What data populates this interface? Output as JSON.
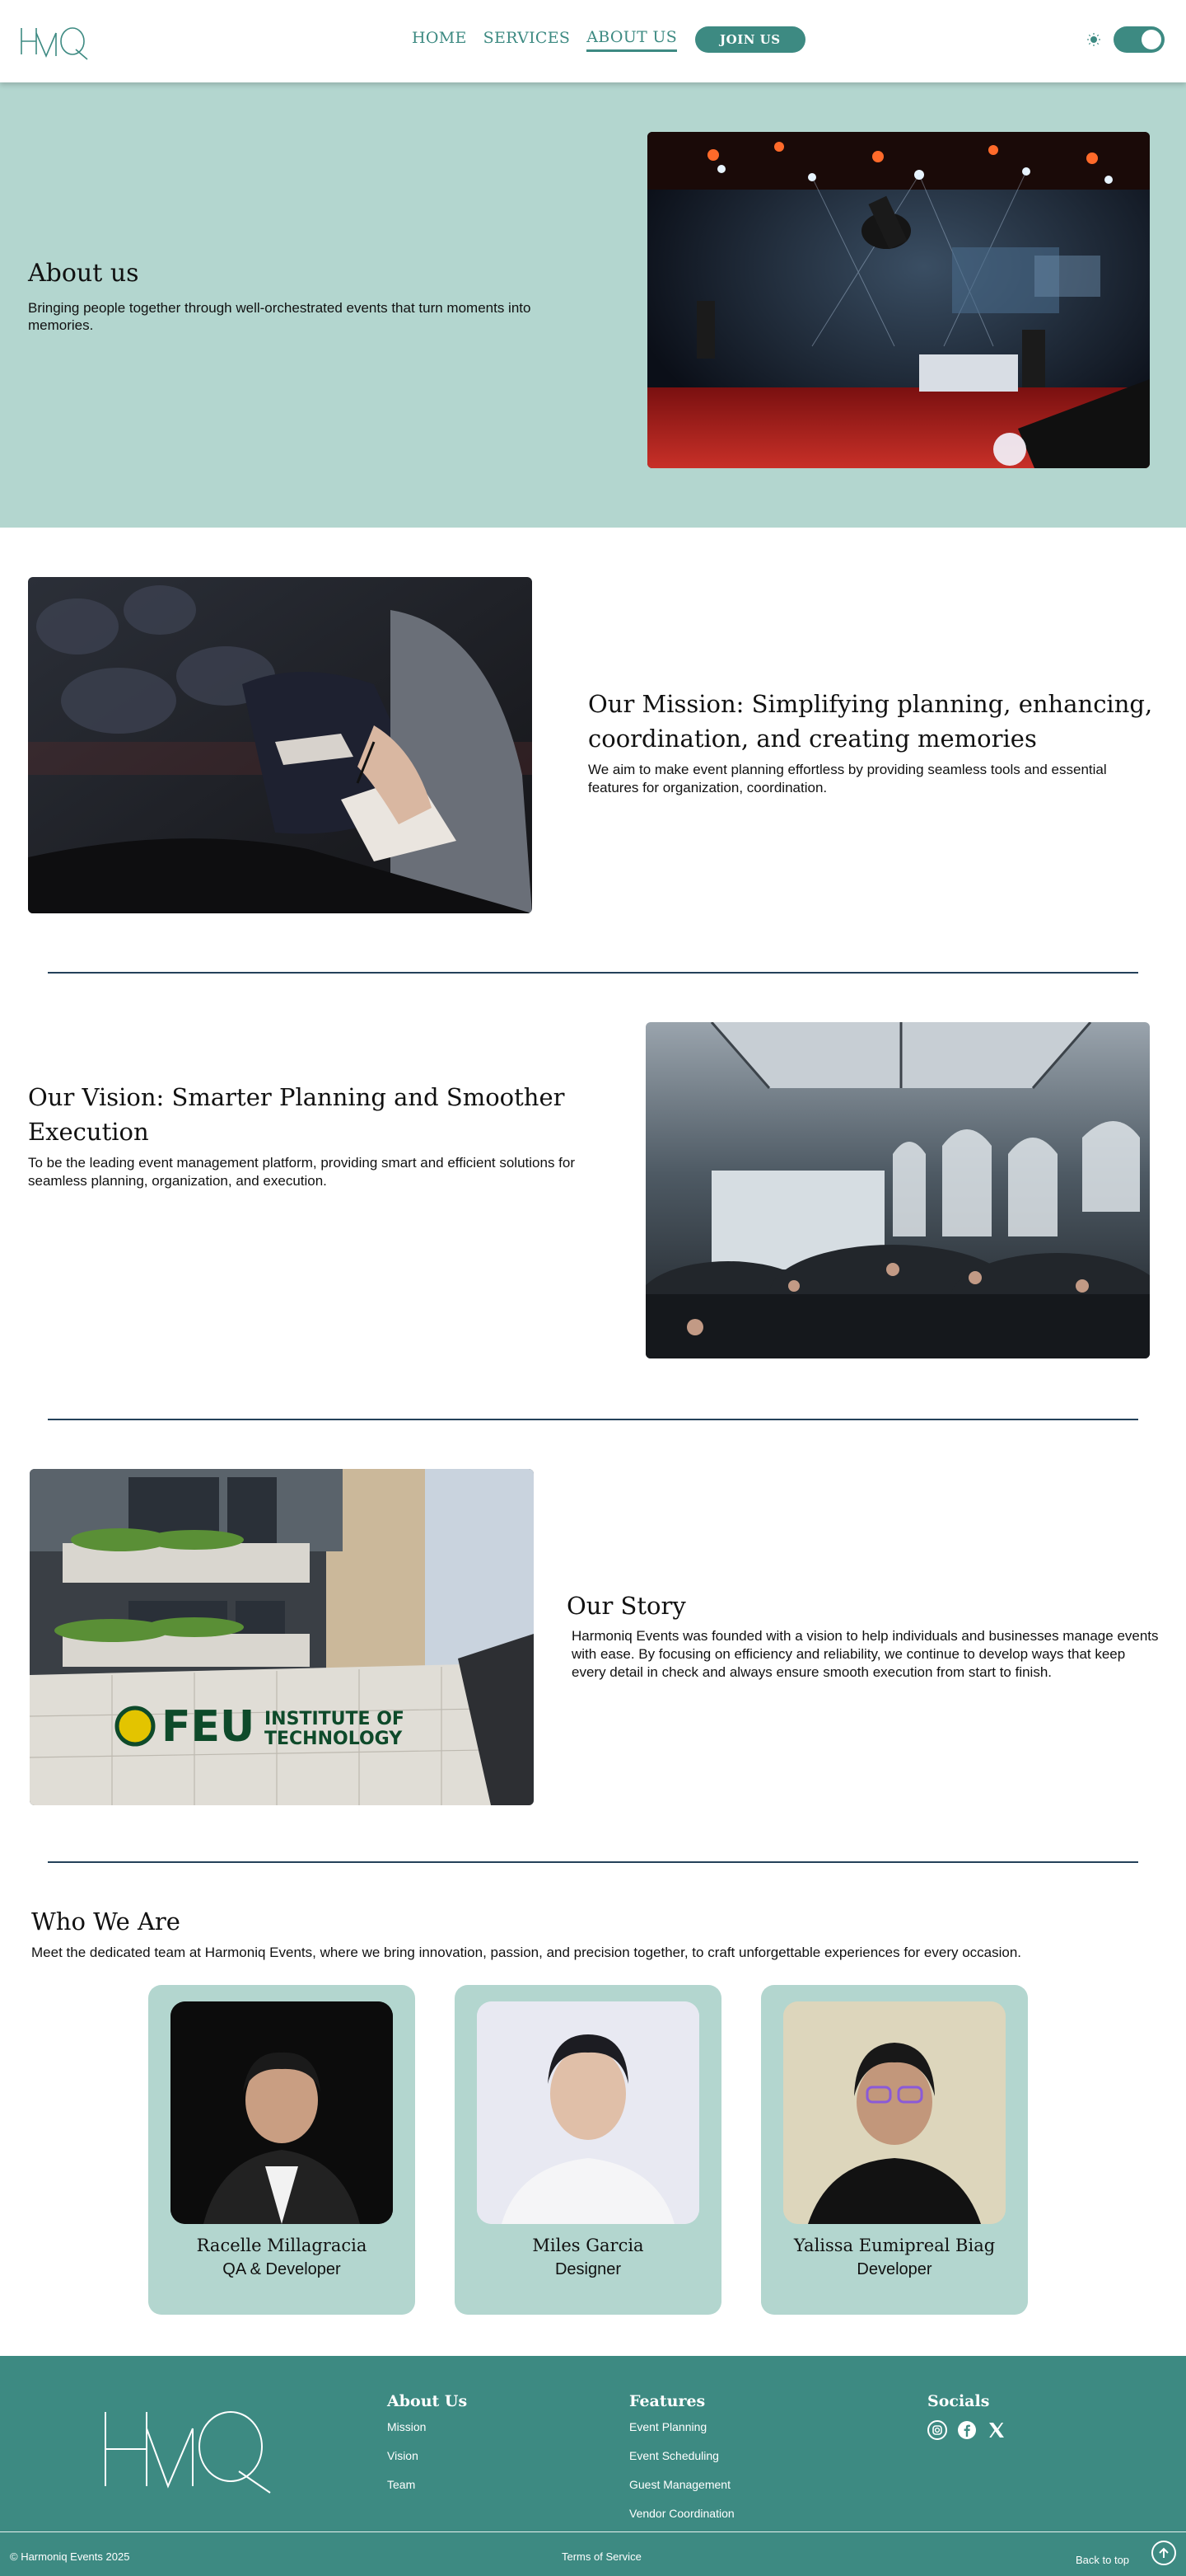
{
  "header": {
    "nav": [
      "HOME",
      "SERVICES",
      "ABOUT US"
    ],
    "join_label": "JOIN US",
    "theme_icon": "sun-icon"
  },
  "about": {
    "title": "About us",
    "text": "Bringing people together through well-orchestrated events that turn moments into memories."
  },
  "mission": {
    "title": "Our Mission: Simplifying planning, enhancing, coordination, and creating memories",
    "text": "We aim to make event planning effortless by providing seamless tools and essential features for organization, coordination."
  },
  "vision": {
    "title": "Our Vision: Smarter Planning and Smoother Execution",
    "text": "To be the leading event management platform, providing smart and efficient solutions for seamless planning, organization, and execution."
  },
  "story": {
    "title": "Our Story",
    "text": "Harmoniq Events was founded with a vision to help individuals and businesses manage events with ease. By focusing on efficiency and reliability, we continue to develop ways that keep every detail in check and always ensure smooth execution from start to finish.",
    "sign_line1": "FEU",
    "sign_line2": "INSTITUTE OF",
    "sign_line3": "TECHNOLOGY"
  },
  "team": {
    "title": "Who We Are",
    "subtitle": "Meet the dedicated team at Harmoniq Events, where we bring innovation, passion, and precision together, to craft unforgettable experiences for every occasion.",
    "members": [
      {
        "name": "Racelle Millagracia",
        "role": "QA & Developer"
      },
      {
        "name": "Miles Garcia",
        "role": "Designer"
      },
      {
        "name": "Yalissa Eumipreal Biag",
        "role": "Developer"
      }
    ]
  },
  "footer": {
    "about": {
      "title": "About Us",
      "links": [
        "Mission",
        "Vision",
        "Team"
      ]
    },
    "features": {
      "title": "Features",
      "links": [
        "Event Planning",
        "Event Scheduling",
        "Guest Management",
        "Vendor Coordination"
      ]
    },
    "socials": {
      "title": "Socials",
      "icons": [
        "instagram-icon",
        "facebook-icon",
        "x-icon"
      ]
    },
    "copyright": "© Harmoniq Events 2025",
    "terms": "Terms of Service",
    "back_to_top": "Back to top"
  },
  "colors": {
    "teal": "#3d8a82",
    "mint": "#b3d6cf",
    "divider": "#24415a"
  }
}
